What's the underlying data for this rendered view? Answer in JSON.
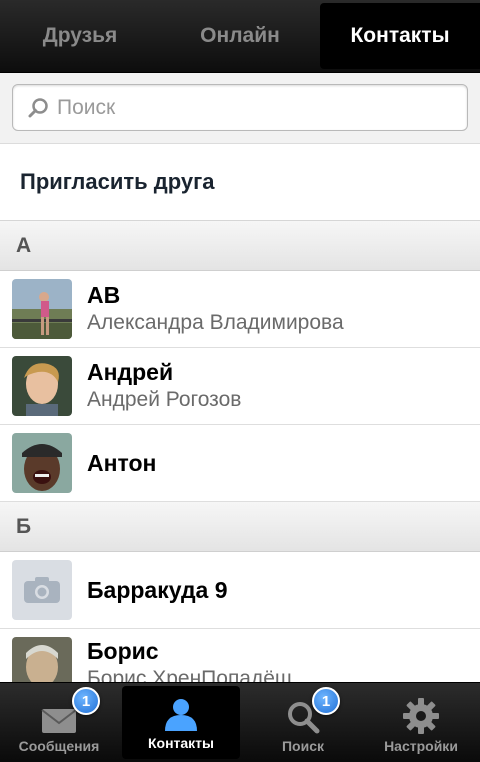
{
  "top_tabs": [
    {
      "label": "Друзья",
      "active": false
    },
    {
      "label": "Онлайн",
      "active": false
    },
    {
      "label": "Контакты",
      "active": true
    }
  ],
  "search": {
    "placeholder": "Поиск",
    "value": ""
  },
  "invite_label": "Пригласить друга",
  "sections": [
    {
      "letter": "А"
    },
    {
      "letter": "Б"
    }
  ],
  "contacts": [
    {
      "nick": "АВ",
      "full_name": "Александра Владимирова",
      "avatar": "photo"
    },
    {
      "nick": "Андрей",
      "full_name": "Андрей Рогозов",
      "avatar": "photo"
    },
    {
      "nick": "Антон",
      "full_name": "",
      "avatar": "photo"
    },
    {
      "nick": "Барракуда 9",
      "full_name": "",
      "avatar": "camera-placeholder"
    },
    {
      "nick": "Борис",
      "full_name": "Борис ХренПопадёш",
      "avatar": "photo"
    }
  ],
  "bottom_tabs": [
    {
      "label": "Сообщения",
      "icon": "envelope-icon",
      "badge": "1",
      "active": false
    },
    {
      "label": "Контакты",
      "icon": "person-icon",
      "badge": "",
      "active": true
    },
    {
      "label": "Поиск",
      "icon": "magnifier-icon",
      "badge": "1",
      "active": false
    },
    {
      "label": "Настройки",
      "icon": "gear-icon",
      "badge": "",
      "active": false
    }
  ],
  "colors": {
    "accent": "#1f6fd6",
    "active_icon": "#4aa3ff"
  }
}
